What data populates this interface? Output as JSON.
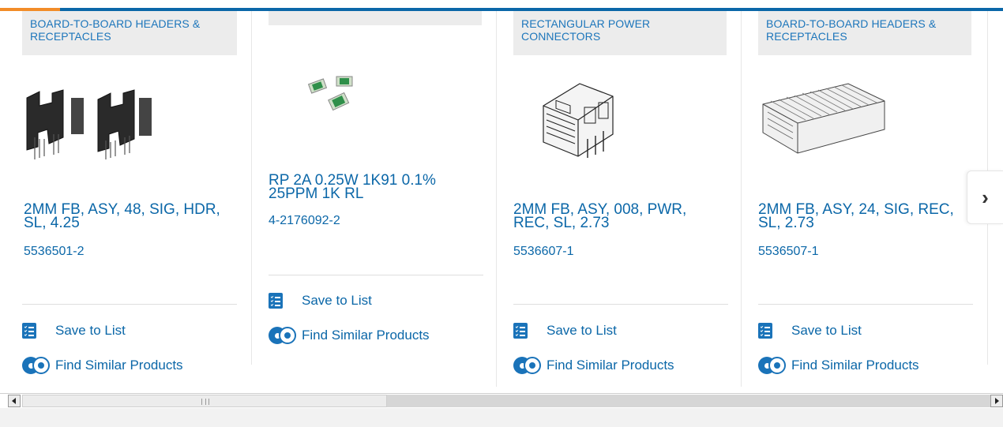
{
  "carousel": {
    "cards": [
      {
        "category": "BOARD-TO-BOARD HEADERS & RECEPTACLES",
        "image_icon": "connector-header-image",
        "title": "2MM FB, ASY, 48, SIG, HDR, SL, 4.25",
        "part_number": "5536501-2",
        "save_label": "Save to List",
        "similar_label": "Find Similar Products"
      },
      {
        "category": "",
        "image_icon": "chip-resistor-image",
        "title": "RP 2A 0.25W 1K91 0.1% 25PPM 1K RL",
        "part_number": "4-2176092-2",
        "save_label": "Save to List",
        "similar_label": "Find Similar Products"
      },
      {
        "category": "RECTANGULAR POWER CONNECTORS",
        "image_icon": "power-connector-image",
        "title": "2MM FB, ASY, 008, PWR, REC, SL, 2.73",
        "part_number": "5536607-1",
        "save_label": "Save to List",
        "similar_label": "Find Similar Products"
      },
      {
        "category": "BOARD-TO-BOARD HEADERS & RECEPTACLES",
        "image_icon": "receptacle-image",
        "title": "2MM FB, ASY, 24, SIG, REC, SL, 2.73",
        "part_number": "5536507-1",
        "save_label": "Save to List",
        "similar_label": "Find Similar Products"
      }
    ],
    "next_icon": "chevron-right-icon"
  },
  "colors": {
    "link_blue": "#0b67a8",
    "accent_orange": "#f28c28",
    "category_bg": "#ececec"
  }
}
